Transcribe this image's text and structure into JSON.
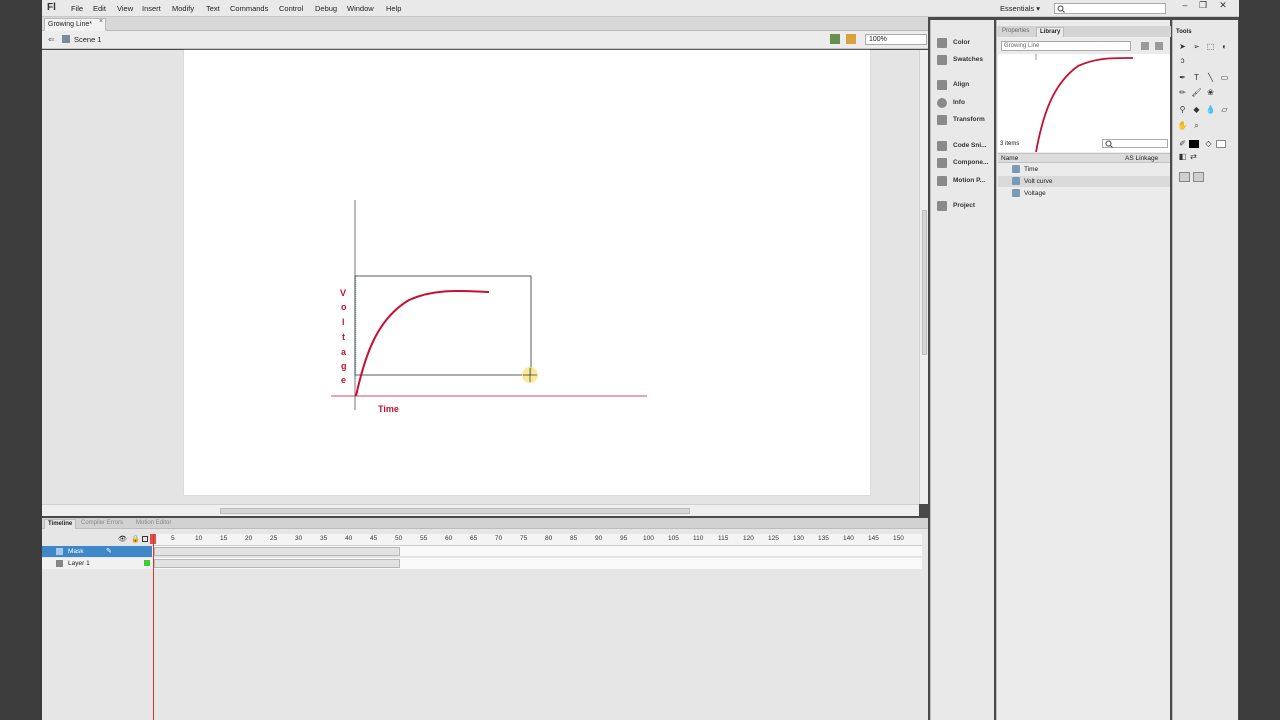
{
  "menubar": {
    "logo": "Fl",
    "items": [
      "File",
      "Edit",
      "View",
      "Insert",
      "Modify",
      "Text",
      "Commands",
      "Control",
      "Debug",
      "Window",
      "Help"
    ],
    "workspace": "Essentials",
    "workspace_arrow": "▾"
  },
  "document": {
    "tab_title": "Growing Line*",
    "tab_close": "×",
    "scene": "Scene 1",
    "zoom": "100%"
  },
  "stage": {
    "axis_y_letters": [
      "V",
      "o",
      "l",
      "t",
      "a",
      "g",
      "e"
    ],
    "axis_x_label": "Time",
    "colors": {
      "axis": "#c8102e",
      "curve": "#c8102e",
      "guide": "#6fc7e0"
    }
  },
  "timeline": {
    "tabs": [
      "Timeline",
      "Compiler Errors",
      "Motion Editor"
    ],
    "frame_numbers": [
      "5",
      "10",
      "15",
      "20",
      "25",
      "30",
      "35",
      "40",
      "45",
      "50",
      "55",
      "60",
      "65",
      "70",
      "75",
      "80",
      "85",
      "90",
      "95",
      "100",
      "105",
      "110",
      "115",
      "120",
      "125",
      "130",
      "135",
      "140",
      "145",
      "150"
    ],
    "layers": [
      {
        "name": "Mask",
        "selected": true
      },
      {
        "name": "Layer 1",
        "selected": false
      }
    ]
  },
  "dock": {
    "items": [
      "Color",
      "Swatches",
      "Align",
      "Info",
      "Transform",
      "Code Sni...",
      "Compone...",
      "Motion P...",
      "Project"
    ]
  },
  "library": {
    "tabs": [
      "Properties",
      "Library"
    ],
    "document": "Growing Line",
    "item_count": "3 items",
    "columns": [
      "Name",
      "AS Linkage"
    ],
    "items": [
      "Time",
      "Volt curve",
      "Voltage"
    ]
  },
  "tools": {
    "title": "Tools"
  }
}
